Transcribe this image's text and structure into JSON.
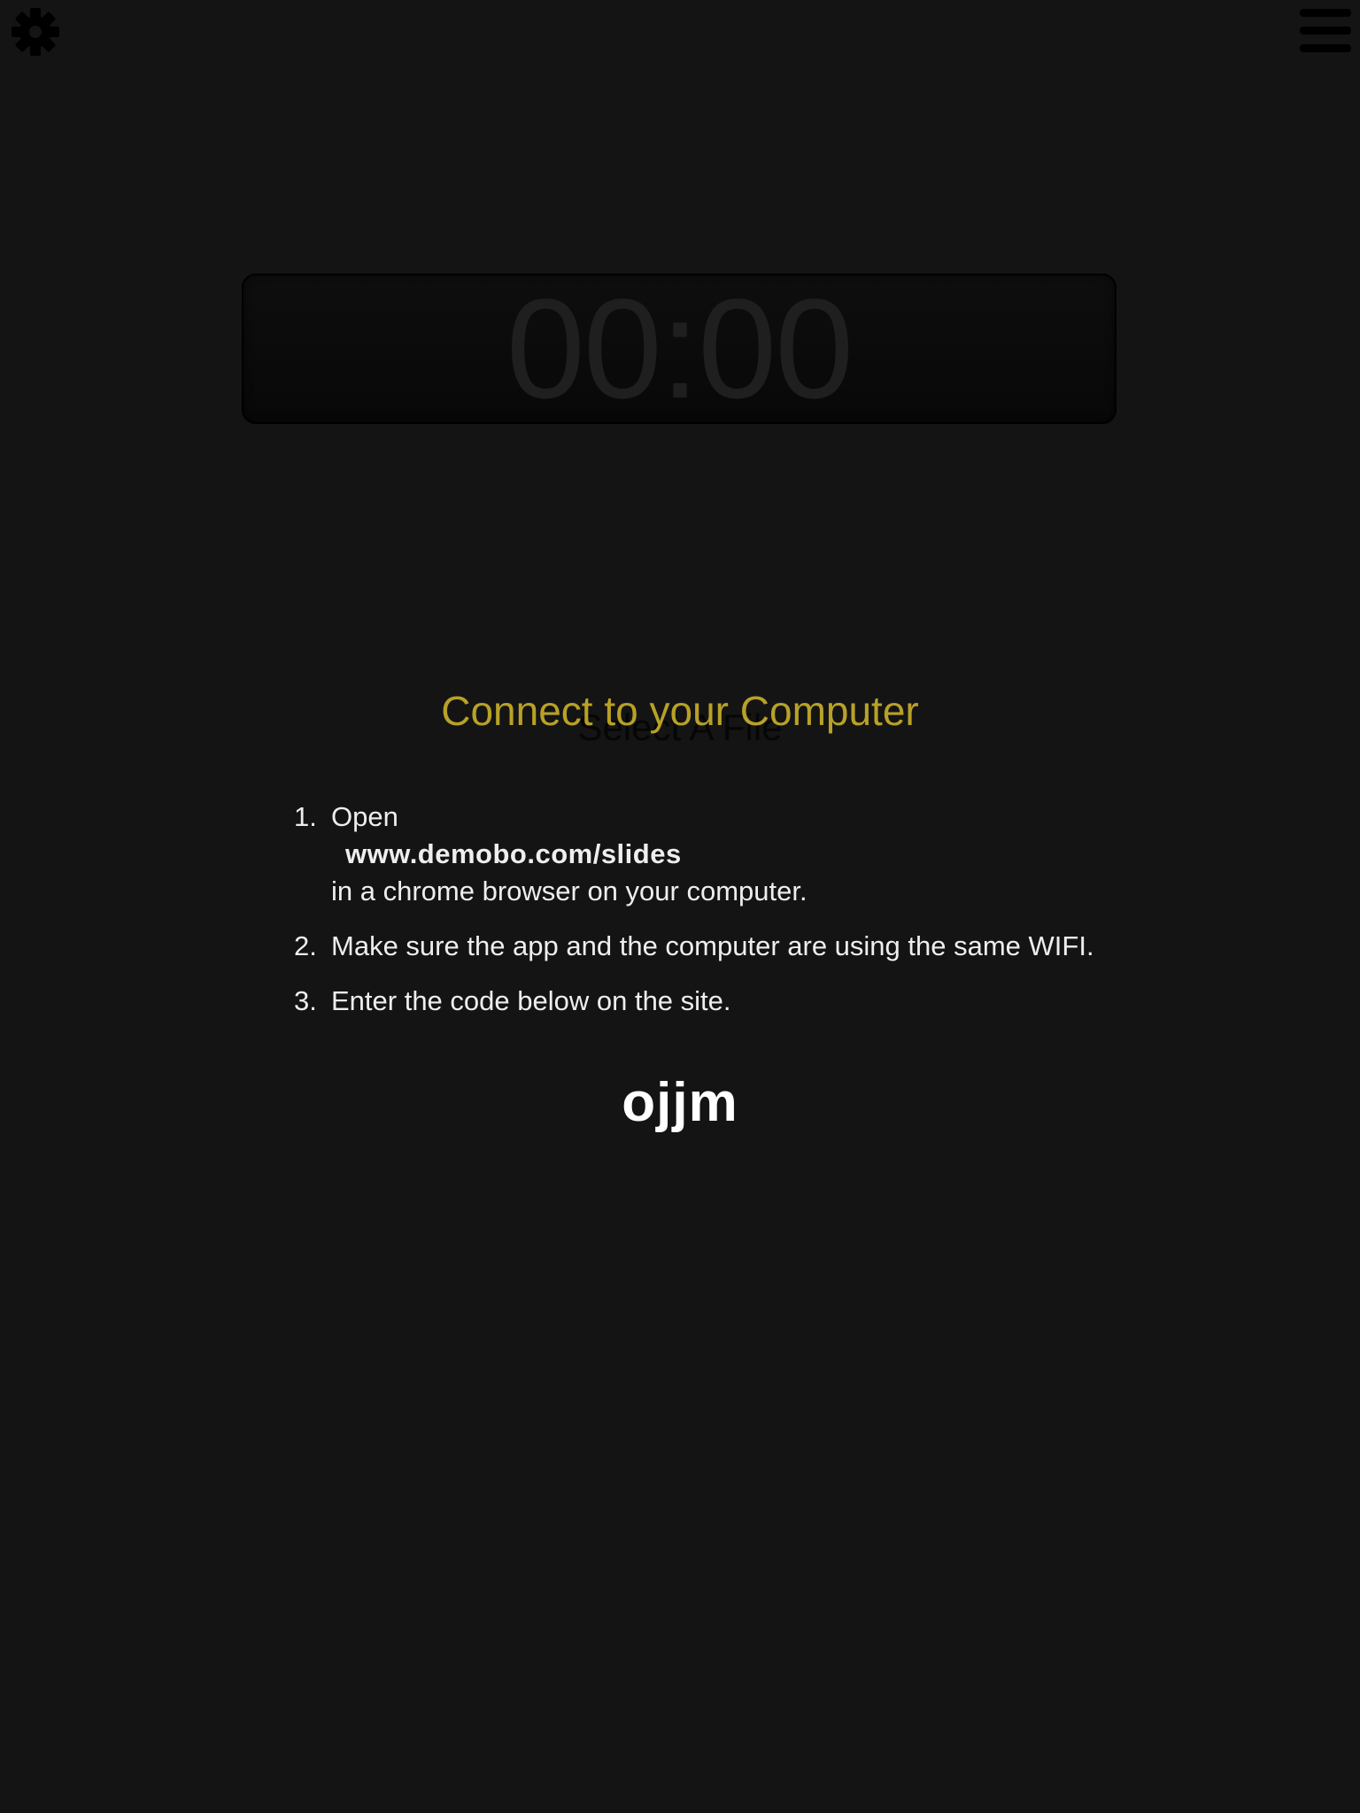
{
  "toolbar": {
    "settings_icon": "gear-icon",
    "menu_icon": "hamburger-menu-icon"
  },
  "timer": {
    "value": "00:00"
  },
  "background_title": "Select A File",
  "connect": {
    "title": "Connect to your Computer",
    "title_color": "#b8a127",
    "steps": [
      {
        "number": "1.",
        "text_before": "Open",
        "link": "www.demobo.com/slides",
        "text_after": "in a chrome browser on your computer."
      },
      {
        "number": "2.",
        "text": "Make sure the app and the computer are using the same WIFI."
      },
      {
        "number": "3.",
        "text": "Enter the code below on the site."
      }
    ],
    "code": "ojjm"
  }
}
